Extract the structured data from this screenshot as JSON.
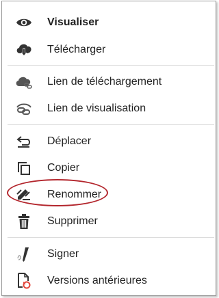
{
  "menu": {
    "items": [
      {
        "label": "Visualiser",
        "icon": "eye-icon",
        "bold": true
      },
      {
        "label": "Télécharger",
        "icon": "cloud-download-icon"
      },
      {
        "label": "Lien de téléchargement",
        "icon": "cloud-link-icon"
      },
      {
        "label": "Lien de visualisation",
        "icon": "eye-link-icon"
      },
      {
        "label": "Déplacer",
        "icon": "move-arrow-icon"
      },
      {
        "label": "Copier",
        "icon": "copy-icon"
      },
      {
        "label": "Renommer",
        "icon": "rename-icon"
      },
      {
        "label": "Supprimer",
        "icon": "trash-icon"
      },
      {
        "label": "Signer",
        "icon": "signature-pen-icon"
      },
      {
        "label": "Versions antérieures",
        "icon": "file-history-icon"
      }
    ]
  },
  "colors": {
    "icon": "#333333",
    "icon_muted": "#8a8a8a",
    "text": "#222222",
    "separator": "#dcdcdc",
    "highlight": "#b3262d",
    "history_accent": "#e4463b"
  }
}
